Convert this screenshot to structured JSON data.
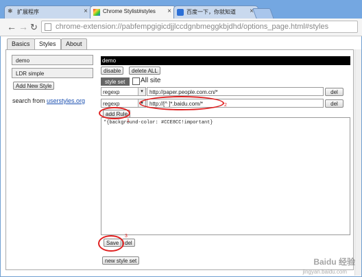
{
  "browser": {
    "tabs": [
      {
        "label": "扩展程序"
      },
      {
        "label": "Chrome Stylist#styles"
      },
      {
        "label": "百度一下，你就知道"
      }
    ],
    "close_glyph": "×",
    "url_scheme": "chrome-extension://",
    "url_rest": "pabfempgigicdjjlccdgnbmeggkbjdhd/options_page.html#styles"
  },
  "page_tabs": [
    "Basics",
    "Styles",
    "About"
  ],
  "sidebar": {
    "styles": [
      "demo",
      "LDR simple"
    ],
    "add_button": "Add New Style",
    "search_prefix": "search from ",
    "search_link": "userstyles.org"
  },
  "editor": {
    "style_name": "demo",
    "disable_button": "disable",
    "delete_all_button": "delete ALL",
    "style_set_label": "style set",
    "all_site_label": "All site",
    "rules": [
      {
        "type": "regexp",
        "pattern": "http://paper.people.com.cn/*",
        "del": "del"
      },
      {
        "type": "regexp",
        "pattern": "http://[^ ]*.baidu.com/*",
        "del": "del"
      }
    ],
    "add_rule_button": "add Rule",
    "css": "*{background-color: #CCE8CC!important}",
    "save_button": "Save",
    "del_button": "del",
    "new_style_set_button": "new style set"
  },
  "annotations": [
    "2",
    "1",
    "3"
  ],
  "watermark": {
    "text": "Baidu 经验",
    "sub": "jingyan.baidu.com"
  }
}
